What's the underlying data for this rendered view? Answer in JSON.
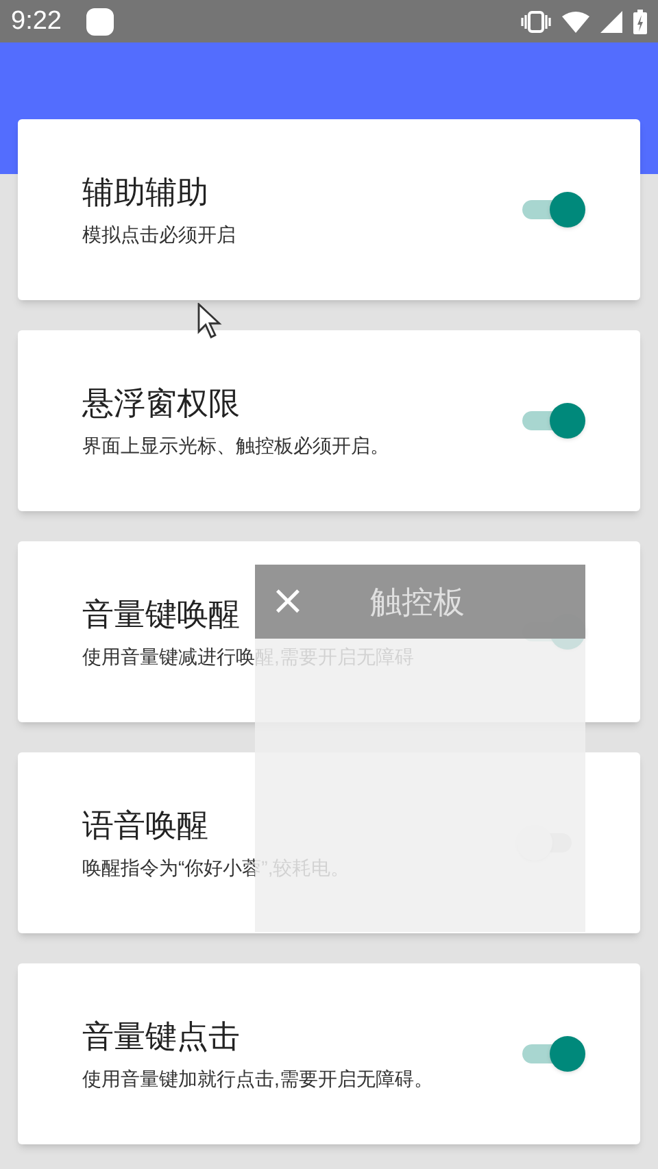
{
  "status_bar": {
    "time": "9:22"
  },
  "settings": [
    {
      "title": "辅助辅助",
      "subtitle": "模拟点击必须开启",
      "on": true
    },
    {
      "title": "悬浮窗权限",
      "subtitle": "界面上显示光标、触控板必须开启。",
      "on": true
    },
    {
      "title": "音量键唤醒",
      "subtitle": "使用音量键减进行唤醒,需要开启无障碍",
      "on": true
    },
    {
      "title": "语音唤醒",
      "subtitle": "唤醒指令为“你好小蓉”,较耗电。",
      "on": false
    },
    {
      "title": "音量键点击",
      "subtitle": "使用音量键加就行点击,需要开启无障碍。",
      "on": true
    }
  ],
  "touchpad": {
    "close": "×",
    "title": "触控板"
  }
}
